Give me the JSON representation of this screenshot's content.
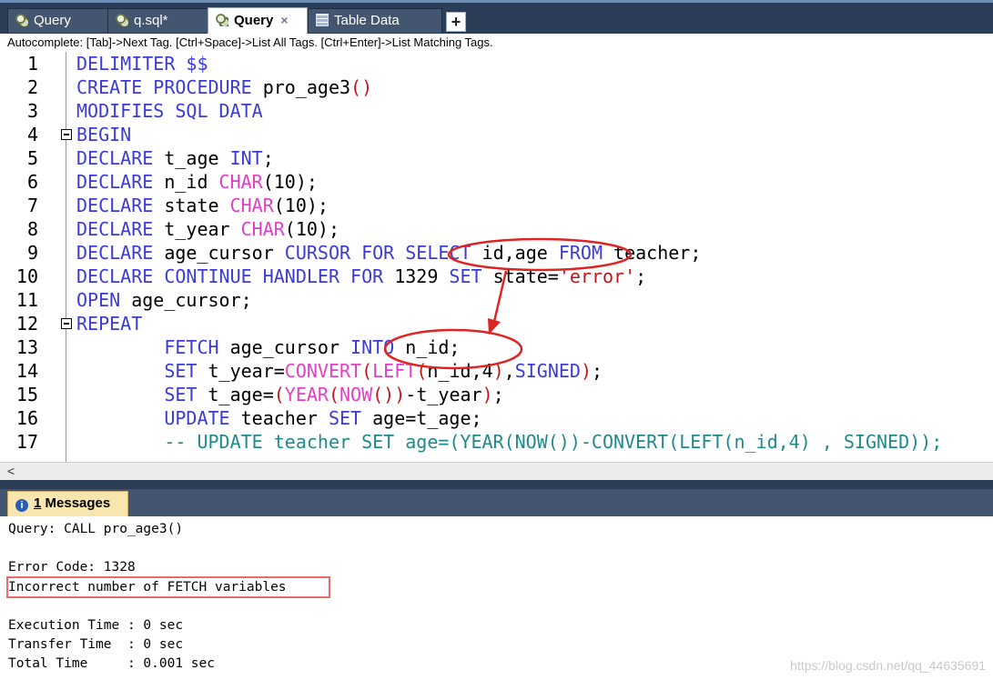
{
  "tabs": [
    {
      "label": "Query",
      "icon": "query-icon"
    },
    {
      "label": "q.sql*",
      "icon": "query-icon"
    },
    {
      "label": "Query",
      "icon": "query-icon",
      "active": true
    },
    {
      "label": "Table Data",
      "icon": "table-icon"
    }
  ],
  "new_tab_label": "+",
  "close_label": "×",
  "hint": "Autocomplete: [Tab]->Next Tag. [Ctrl+Space]->List All Tags. [Ctrl+Enter]->List Matching Tags.",
  "editor": {
    "line_numbers": [
      "1",
      "2",
      "3",
      "4",
      "5",
      "6",
      "7",
      "8",
      "9",
      "10",
      "11",
      "12",
      "13",
      "14",
      "15",
      "16",
      "17"
    ],
    "lines": [
      [
        {
          "c": "kw",
          "t": "DELIMITER $$"
        }
      ],
      [
        {
          "c": "kw",
          "t": "CREATE PROCEDURE "
        },
        {
          "c": "tx",
          "t": "pro_age3"
        },
        {
          "c": "pn",
          "t": "()"
        }
      ],
      [
        {
          "c": "kw",
          "t": "MODIFIES SQL DATA"
        }
      ],
      [
        {
          "c": "kw",
          "t": "BEGIN"
        }
      ],
      [
        {
          "c": "kw",
          "t": "DECLARE "
        },
        {
          "c": "tx",
          "t": "t_age "
        },
        {
          "c": "kw",
          "t": "INT"
        },
        {
          "c": "tx",
          "t": ";"
        }
      ],
      [
        {
          "c": "kw",
          "t": "DECLARE "
        },
        {
          "c": "tx",
          "t": "n_id "
        },
        {
          "c": "fn",
          "t": "CHAR"
        },
        {
          "c": "tx",
          "t": "(10);"
        }
      ],
      [
        {
          "c": "kw",
          "t": "DECLARE "
        },
        {
          "c": "tx",
          "t": "state "
        },
        {
          "c": "fn",
          "t": "CHAR"
        },
        {
          "c": "tx",
          "t": "(10);"
        }
      ],
      [
        {
          "c": "kw",
          "t": "DECLARE "
        },
        {
          "c": "tx",
          "t": "t_year "
        },
        {
          "c": "fn",
          "t": "CHAR"
        },
        {
          "c": "tx",
          "t": "(10);"
        }
      ],
      [
        {
          "c": "kw",
          "t": "DECLARE "
        },
        {
          "c": "tx",
          "t": "age_cursor "
        },
        {
          "c": "kw",
          "t": "CURSOR FOR SELECT "
        },
        {
          "c": "tx",
          "t": "id,age "
        },
        {
          "c": "kw",
          "t": "FROM "
        },
        {
          "c": "tx",
          "t": "teacher;"
        }
      ],
      [
        {
          "c": "kw",
          "t": "DECLARE CONTINUE HANDLER FOR "
        },
        {
          "c": "tx",
          "t": "1329 "
        },
        {
          "c": "kw",
          "t": "SET "
        },
        {
          "c": "tx",
          "t": "state="
        },
        {
          "c": "str",
          "t": "'error'"
        },
        {
          "c": "tx",
          "t": ";"
        }
      ],
      [
        {
          "c": "kw",
          "t": "OPEN "
        },
        {
          "c": "tx",
          "t": "age_cursor;"
        }
      ],
      [
        {
          "c": "kw",
          "t": "REPEAT"
        }
      ],
      [
        {
          "c": "tx",
          "t": "        "
        },
        {
          "c": "kw",
          "t": "FETCH "
        },
        {
          "c": "tx",
          "t": "age_cursor "
        },
        {
          "c": "kw",
          "t": "INTO "
        },
        {
          "c": "tx",
          "t": "n_id;"
        }
      ],
      [
        {
          "c": "tx",
          "t": "        "
        },
        {
          "c": "kw",
          "t": "SET "
        },
        {
          "c": "tx",
          "t": "t_year="
        },
        {
          "c": "fn",
          "t": "CONVERT"
        },
        {
          "c": "pn",
          "t": "("
        },
        {
          "c": "fn",
          "t": "LEFT"
        },
        {
          "c": "pn",
          "t": "("
        },
        {
          "c": "tx",
          "t": "n_id,4"
        },
        {
          "c": "pn",
          "t": ")"
        },
        {
          "c": "tx",
          "t": ","
        },
        {
          "c": "kw",
          "t": "SIGNED"
        },
        {
          "c": "pn",
          "t": ")"
        },
        {
          "c": "tx",
          "t": ";"
        }
      ],
      [
        {
          "c": "tx",
          "t": "        "
        },
        {
          "c": "kw",
          "t": "SET "
        },
        {
          "c": "tx",
          "t": "t_age="
        },
        {
          "c": "pn",
          "t": "("
        },
        {
          "c": "fn",
          "t": "YEAR"
        },
        {
          "c": "pn",
          "t": "("
        },
        {
          "c": "fn",
          "t": "NOW"
        },
        {
          "c": "pn",
          "t": "()"
        },
        {
          "c": "pn",
          "t": ")"
        },
        {
          "c": "tx",
          "t": "-t_year"
        },
        {
          "c": "pn",
          "t": ")"
        },
        {
          "c": "tx",
          "t": ";"
        }
      ],
      [
        {
          "c": "tx",
          "t": "        "
        },
        {
          "c": "kw",
          "t": "UPDATE "
        },
        {
          "c": "tx",
          "t": "teacher "
        },
        {
          "c": "kw",
          "t": "SET "
        },
        {
          "c": "tx",
          "t": "age=t_age;"
        }
      ],
      [
        {
          "c": "tx",
          "t": "        "
        },
        {
          "c": "cmt",
          "t": "-- UPDATE teacher SET age=(YEAR(NOW())-CONVERT(LEFT(n_id,4) , SIGNED));"
        }
      ]
    ],
    "fold_lines": [
      4,
      12
    ]
  },
  "scroll_left_label": "<",
  "messages_tab": {
    "count": "1",
    "label": "Messages"
  },
  "messages": {
    "query": "Query: CALL pro_age3()",
    "error_code": "Error Code: 1328",
    "error_text": "Incorrect number of FETCH variables",
    "execution_time": "Execution Time : 0 sec",
    "transfer_time": "Transfer Time  : 0 sec",
    "total_time": "Total Time     : 0.001 sec"
  },
  "watermark": "https://blog.csdn.net/qq_44635691",
  "colors": {
    "keyword": "#3b3bd6",
    "function": "#e23fc8",
    "string": "#c2171a",
    "comment": "#1e8a8c",
    "annotation": "#e02424",
    "tabbar": "#2c3e57"
  }
}
